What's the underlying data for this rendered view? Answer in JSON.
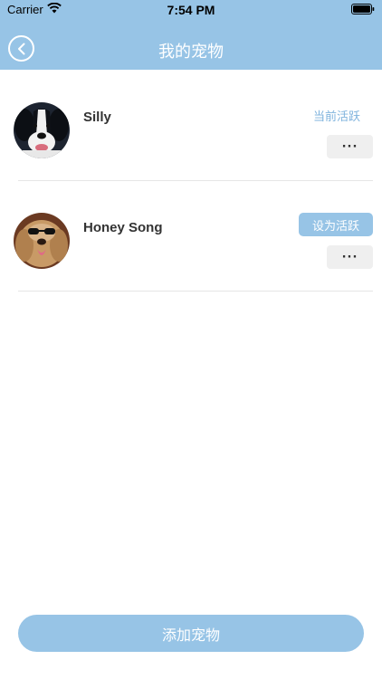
{
  "status_bar": {
    "carrier": "Carrier",
    "time": "7:54 PM"
  },
  "header": {
    "title": "我的宠物",
    "back_icon": "chevron-left-circle-icon"
  },
  "pets": [
    {
      "name": "Silly",
      "status": "当前活跃",
      "more_label": "···"
    },
    {
      "name": "Honey Song",
      "action": "设为活跃",
      "more_label": "···"
    }
  ],
  "footer": {
    "add_label": "添加宠物"
  },
  "colors": {
    "accent": "#97c4e6",
    "status_text": "#7fb3dd",
    "more_bg": "#efefef"
  }
}
